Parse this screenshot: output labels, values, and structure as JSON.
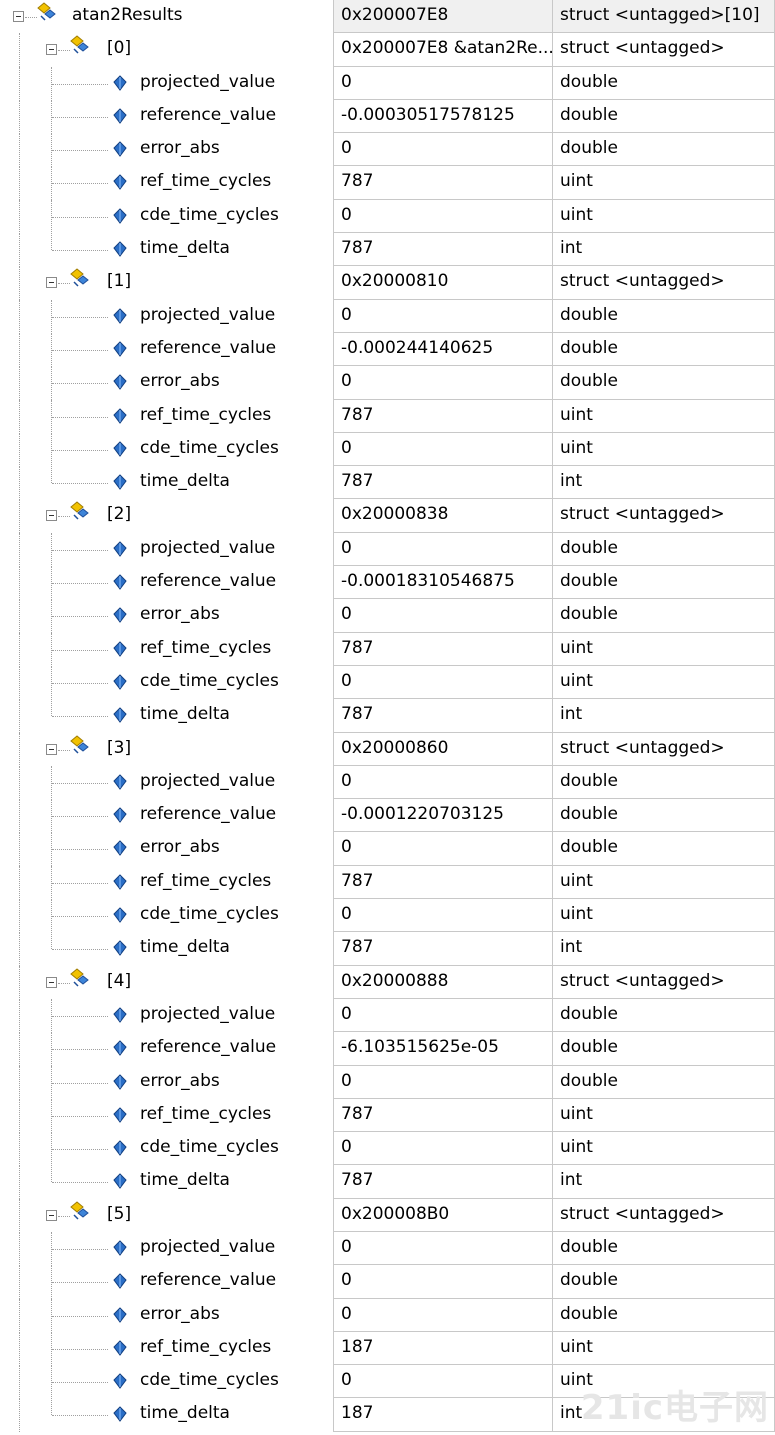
{
  "window": {
    "title": ""
  },
  "root": {
    "name": "atan2Results",
    "value": "0x200007E8",
    "type": "struct <untagged>[10]"
  },
  "items": [
    {
      "index": "[0]",
      "value": "0x200007E8 &atan2Re...",
      "type": "struct <untagged>",
      "fields": [
        {
          "name": "projected_value",
          "value": "0",
          "type": "double"
        },
        {
          "name": "reference_value",
          "value": "-0.00030517578125",
          "type": "double"
        },
        {
          "name": "error_abs",
          "value": "0",
          "type": "double"
        },
        {
          "name": "ref_time_cycles",
          "value": "787",
          "type": "uint"
        },
        {
          "name": "cde_time_cycles",
          "value": "0",
          "type": "uint"
        },
        {
          "name": "time_delta",
          "value": "787",
          "type": "int"
        }
      ]
    },
    {
      "index": "[1]",
      "value": "0x20000810",
      "type": "struct <untagged>",
      "fields": [
        {
          "name": "projected_value",
          "value": "0",
          "type": "double"
        },
        {
          "name": "reference_value",
          "value": "-0.000244140625",
          "type": "double"
        },
        {
          "name": "error_abs",
          "value": "0",
          "type": "double"
        },
        {
          "name": "ref_time_cycles",
          "value": "787",
          "type": "uint"
        },
        {
          "name": "cde_time_cycles",
          "value": "0",
          "type": "uint"
        },
        {
          "name": "time_delta",
          "value": "787",
          "type": "int"
        }
      ]
    },
    {
      "index": "[2]",
      "value": "0x20000838",
      "type": "struct <untagged>",
      "fields": [
        {
          "name": "projected_value",
          "value": "0",
          "type": "double"
        },
        {
          "name": "reference_value",
          "value": "-0.00018310546875",
          "type": "double"
        },
        {
          "name": "error_abs",
          "value": "0",
          "type": "double"
        },
        {
          "name": "ref_time_cycles",
          "value": "787",
          "type": "uint"
        },
        {
          "name": "cde_time_cycles",
          "value": "0",
          "type": "uint"
        },
        {
          "name": "time_delta",
          "value": "787",
          "type": "int"
        }
      ]
    },
    {
      "index": "[3]",
      "value": "0x20000860",
      "type": "struct <untagged>",
      "fields": [
        {
          "name": "projected_value",
          "value": "0",
          "type": "double"
        },
        {
          "name": "reference_value",
          "value": "-0.0001220703125",
          "type": "double"
        },
        {
          "name": "error_abs",
          "value": "0",
          "type": "double"
        },
        {
          "name": "ref_time_cycles",
          "value": "787",
          "type": "uint"
        },
        {
          "name": "cde_time_cycles",
          "value": "0",
          "type": "uint"
        },
        {
          "name": "time_delta",
          "value": "787",
          "type": "int"
        }
      ]
    },
    {
      "index": "[4]",
      "value": "0x20000888",
      "type": "struct <untagged>",
      "fields": [
        {
          "name": "projected_value",
          "value": "0",
          "type": "double"
        },
        {
          "name": "reference_value",
          "value": "-6.103515625e-05",
          "type": "double"
        },
        {
          "name": "error_abs",
          "value": "0",
          "type": "double"
        },
        {
          "name": "ref_time_cycles",
          "value": "787",
          "type": "uint"
        },
        {
          "name": "cde_time_cycles",
          "value": "0",
          "type": "uint"
        },
        {
          "name": "time_delta",
          "value": "787",
          "type": "int"
        }
      ]
    },
    {
      "index": "[5]",
      "value": "0x200008B0",
      "type": "struct <untagged>",
      "fields": [
        {
          "name": "projected_value",
          "value": "0",
          "type": "double"
        },
        {
          "name": "reference_value",
          "value": "0",
          "type": "double"
        },
        {
          "name": "error_abs",
          "value": "0",
          "type": "double"
        },
        {
          "name": "ref_time_cycles",
          "value": "187",
          "type": "uint"
        },
        {
          "name": "cde_time_cycles",
          "value": "0",
          "type": "uint"
        },
        {
          "name": "time_delta",
          "value": "187",
          "type": "int"
        }
      ]
    }
  ],
  "icons": {
    "struct": "struct-icon",
    "field": "field-icon",
    "expander": "collapse-icon"
  },
  "colors": {
    "grid": "#c8c8c8",
    "struct_icon_yellow": "#f2c200",
    "struct_icon_blue": "#2a6ec6",
    "field_icon_blue": "#1f5fbf",
    "watermark": "#e6e6e6"
  },
  "watermark": "21ic 电子网"
}
